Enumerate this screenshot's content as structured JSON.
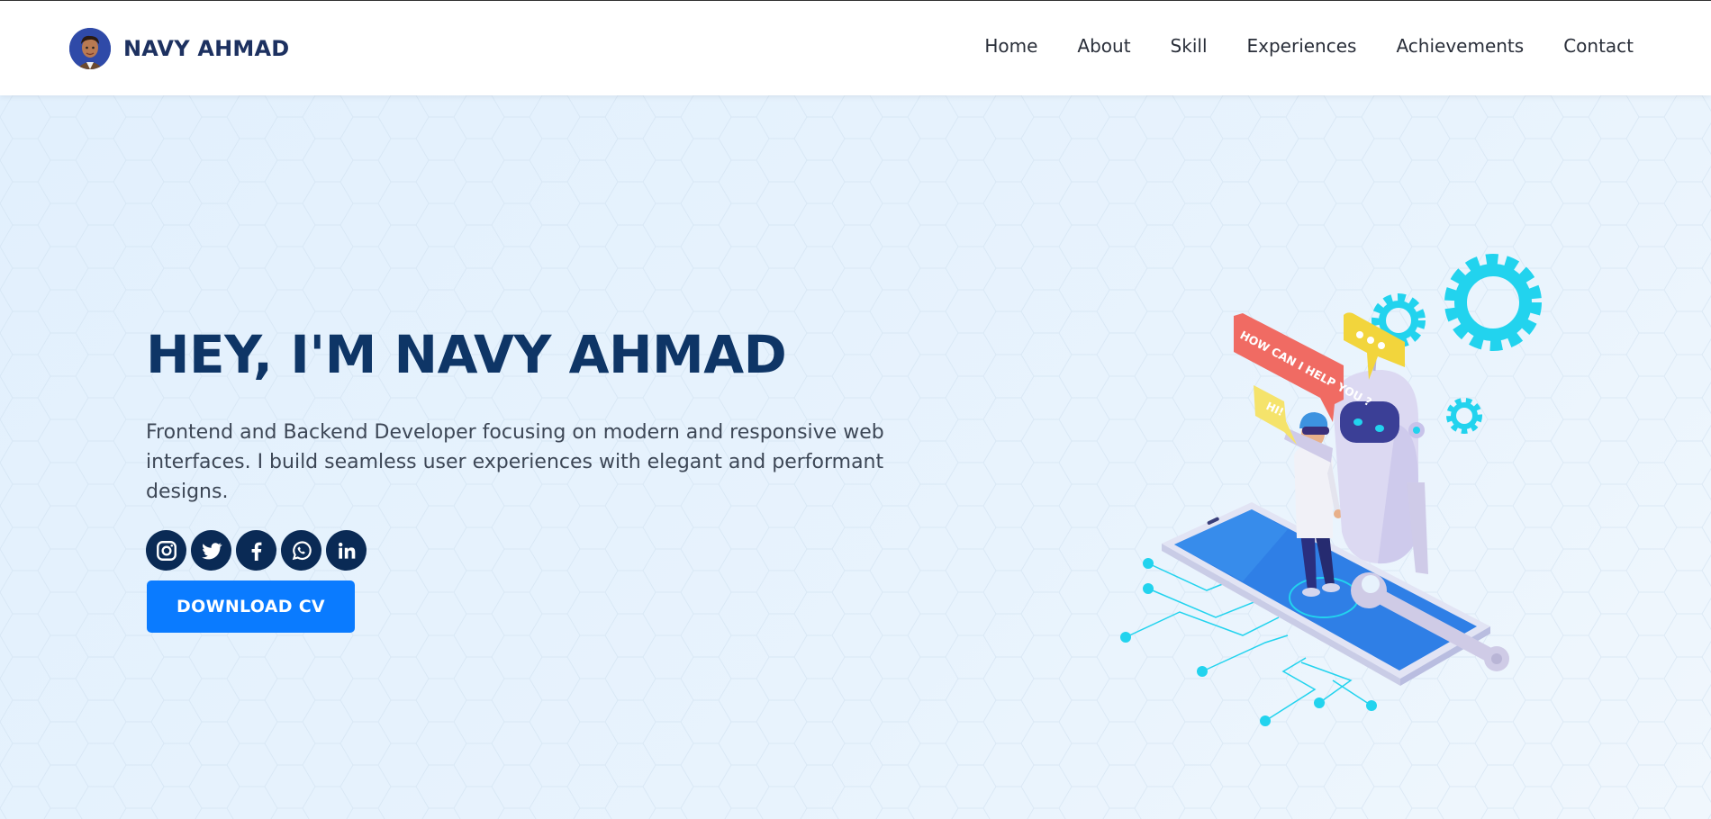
{
  "brand": {
    "name": "NAVY AHMAD",
    "avatar_icon": "avatar-icon"
  },
  "nav": {
    "items": [
      {
        "label": "Home"
      },
      {
        "label": "About"
      },
      {
        "label": "Skill"
      },
      {
        "label": "Experiences"
      },
      {
        "label": "Achievements"
      },
      {
        "label": "Contact"
      }
    ]
  },
  "hero": {
    "title": "HEY, I'M NAVY AHMAD",
    "description": "Frontend and Backend Developer focusing on modern and responsive web interfaces. I build seamless user experiences with elegant and performant designs.",
    "socials": [
      {
        "icon": "instagram-icon"
      },
      {
        "icon": "twitter-icon"
      },
      {
        "icon": "facebook-icon"
      },
      {
        "icon": "whatsapp-icon"
      },
      {
        "icon": "linkedin-icon"
      }
    ],
    "cv_button": "DOWNLOAD CV"
  },
  "illustration": {
    "bubble_help": "HOW CAN I HELP YOU ?",
    "bubble_hi": "HI!"
  },
  "colors": {
    "primary": "#0a7bff",
    "dark_navy": "#0a2a55",
    "title": "#0e3566",
    "cyan": "#22d3ee"
  }
}
